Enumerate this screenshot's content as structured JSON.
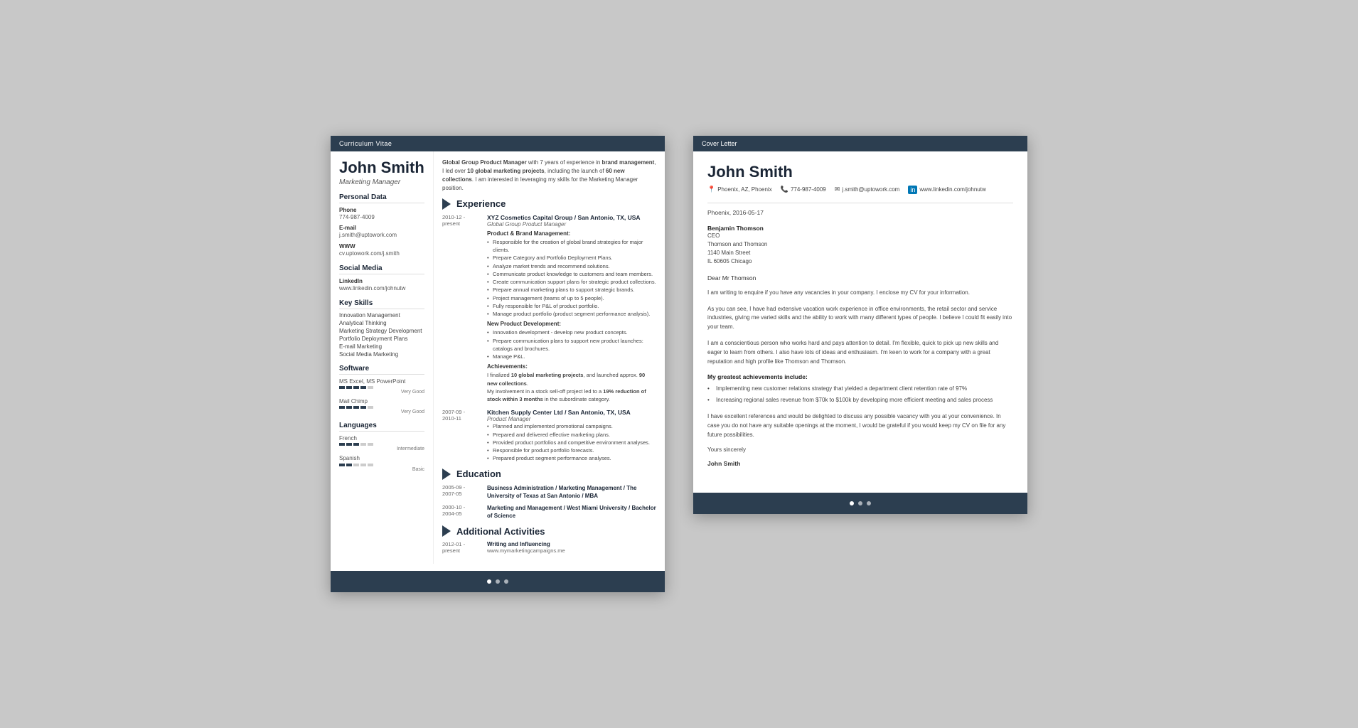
{
  "cv": {
    "header_bar": "Curriculum Vitae",
    "name": "John Smith",
    "title": "Marketing Manager",
    "intro": "Global Group Product Manager with 7 years of experience in brand management, I led over 10 global marketing projects, including the launch of 60 new collections. I am interested in leveraging my skills for the Marketing Manager position.",
    "sidebar": {
      "personal_data_title": "Personal Data",
      "phone_label": "Phone",
      "phone": "774-987-4009",
      "email_label": "E-mail",
      "email": "j.smith@uptowork.com",
      "www_label": "WWW",
      "www": "cv.uptowork.com/j.smith",
      "social_media_title": "Social Media",
      "linkedin_label": "LinkedIn",
      "linkedin": "www.linkedin.com/johnutw",
      "key_skills_title": "Key Skills",
      "skills": [
        "Innovation Management",
        "Analytical Thinking",
        "Marketing Strategy Development",
        "Portfolio Deployment Plans",
        "E-mail Marketing",
        "Social Media Marketing"
      ],
      "software_title": "Software",
      "software": [
        {
          "name": "MS Excel, MS PowerPoint",
          "rating": 4,
          "label": "Very Good"
        },
        {
          "name": "Mail Chimp",
          "rating": 4,
          "label": "Very Good"
        }
      ],
      "languages_title": "Languages",
      "languages": [
        {
          "name": "French",
          "rating": 3,
          "label": "Intermediate"
        },
        {
          "name": "Spanish",
          "rating": 2,
          "label": "Basic"
        }
      ]
    },
    "experience_title": "Experience",
    "experiences": [
      {
        "dates": "2010-12 - present",
        "company": "XYZ Cosmetics Capital Group / San Antonio, TX, USA",
        "role": "Global Group Product Manager",
        "subsections": [
          {
            "title": "Product & Brand Management:",
            "bullets": [
              "Responsible for the creation of global brand strategies for major clients.",
              "Prepare Category and Portfolio Deployment Plans.",
              "Analyze market trends and recommend solutions.",
              "Communicate product knowledge to customers and team members.",
              "Create communication support plans for strategic product collections.",
              "Prepare annual marketing plans to support strategic brands.",
              "Project management (teams of up to 5 people).",
              "Fully responsible for P&L of product portfolio.",
              "Manage product portfolio (product segment performance analysis)."
            ]
          },
          {
            "title": "New Product Development:",
            "bullets": [
              "Innovation development - develop new product concepts.",
              "Prepare communication plans to support new product launches: catalogs and brochures.",
              "Manage P&L."
            ]
          }
        ],
        "achievements_title": "Achievements:",
        "achievements": [
          "I finalized 10 global marketing projects, and launched approx. 90 new collections.",
          "My involvement in a stock sell-off project led to a 19% reduction of stock within 3 months in the subordinate category."
        ]
      },
      {
        "dates": "2007-09 - 2010-11",
        "company": "Kitchen Supply Center Ltd / San Antonio, TX, USA",
        "role": "Product Manager",
        "subsections": [
          {
            "title": "",
            "bullets": [
              "Planned and implemented promotional campaigns.",
              "Prepared and delivered effective marketing plans.",
              "Provided product portfolios and competitive environment analyses.",
              "Responsible for product portfolio forecasts.",
              "Prepared product segment performance analyses."
            ]
          }
        ],
        "achievements_title": "",
        "achievements": []
      }
    ],
    "education_title": "Education",
    "educations": [
      {
        "dates": "2005-09 - 2007-05",
        "degree": "Business Administration / Marketing Management / The University of Texas at San Antonio / MBA"
      },
      {
        "dates": "2000-10 - 2004-05",
        "degree": "Marketing and Management / West Miami University / Bachelor of Science"
      }
    ],
    "activities_title": "Additional Activities",
    "activities": [
      {
        "dates": "2012-01 - present",
        "title": "Writing and Influencing",
        "url": "www.mymarketingcampaigns.me"
      }
    ]
  },
  "cover": {
    "header_bar": "Cover Letter",
    "name": "John Smith",
    "contact": {
      "location": "Phoenix, AZ, Phoenix",
      "phone": "774-987-4009",
      "email": "j.smith@uptowork.com",
      "linkedin": "www.linkedin.com/johnutw"
    },
    "date": "Phoenix, 2016-05-17",
    "recipient": {
      "name": "Benjamin Thomson",
      "title": "CEO",
      "company": "Thomson and Thomson",
      "address": "1140 Main Street",
      "city": "IL 60605 Chicago"
    },
    "greeting": "Dear Mr Thomson",
    "paragraphs": [
      "I am writing to enquire if you have any vacancies in your company. I enclose my CV for your information.",
      "As you can see, I have had extensive vacation work experience in office environments, the retail sector and service industries, giving me varied skills and the ability to work with many different types of people. I believe I could fit easily into your team.",
      "I am a conscientious person who works hard and pays attention to detail. I'm flexible, quick to pick up new skills and eager to learn from others. I also have lots of ideas and enthusiasm. I'm keen to work for a company with a great reputation and high profile like Thomson and Thomson."
    ],
    "achievements_title": "My greatest achievements include:",
    "achievements": [
      "Implementing new customer relations strategy that yielded a department client retention rate of 97%",
      "Increasing regional sales revenue from $70k to $100k by developing more efficient meeting and sales process"
    ],
    "closing": "I have excellent references and would be delighted to discuss any possible vacancy with you at your convenience. In case you do not have any suitable openings at the moment, I would be grateful if you would keep my CV on file for any future possibilities.",
    "yours_sincerely": "Yours sincerely",
    "signature": "John Smith"
  }
}
